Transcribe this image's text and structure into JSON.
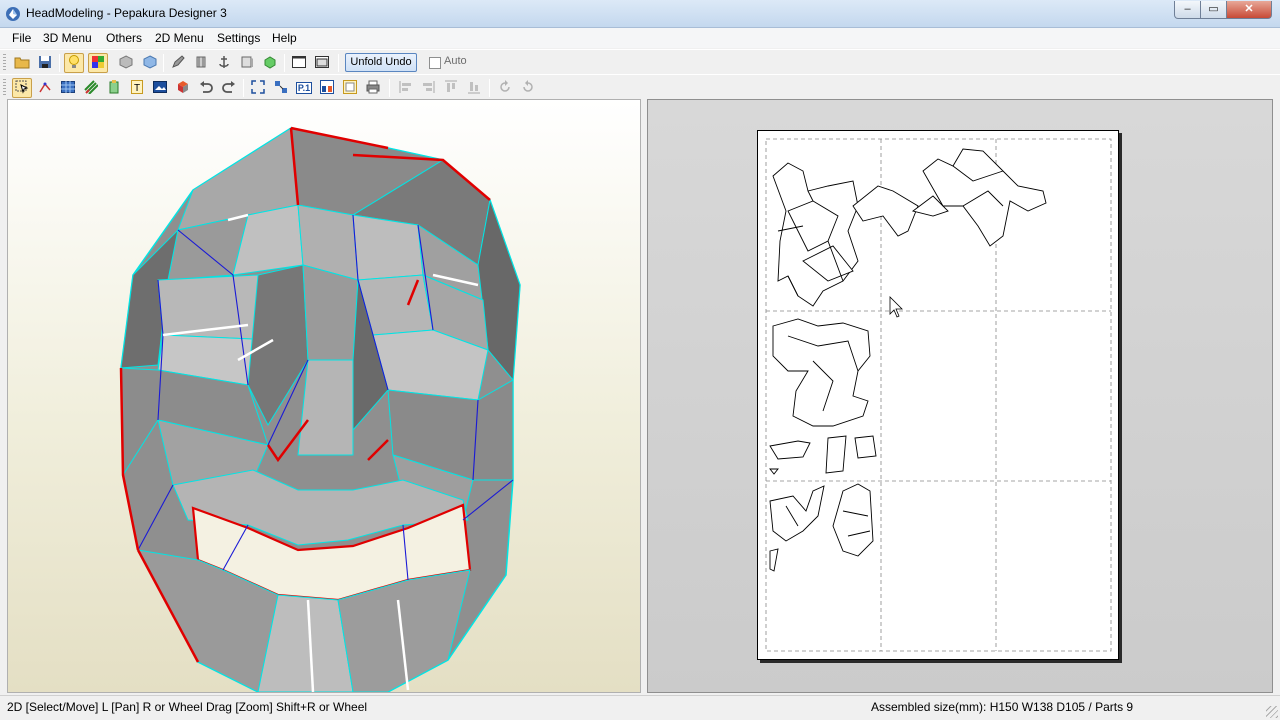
{
  "window": {
    "title": "HeadModeling - Pepakura Designer 3",
    "controls": {
      "minimize": "–",
      "maximize": "▭",
      "close": "✕"
    }
  },
  "menu": [
    "File",
    "3D Menu",
    "Others",
    "2D Menu",
    "Settings",
    "Help"
  ],
  "toolbar": {
    "unfold_undo_label": "Unfold Undo",
    "auto_label": "Auto",
    "auto_checked": false
  },
  "toolbar2": {
    "page_number_label": "P.1"
  },
  "status": {
    "left": "2D [Select/Move] L [Pan] R or Wheel Drag [Zoom] Shift+R or Wheel",
    "right": "Assembled size(mm): H150 W138 D105 / Parts 9"
  },
  "colors": {
    "face_light": "#b3b3b3",
    "face_dark": "#6e6e6e",
    "mountain_fold": "#00e5e5",
    "valley_fold": "#1a1ad6",
    "cut_edge": "#e00000",
    "toggle_active": "#fce8a8"
  },
  "icons": {
    "toolbar1": [
      "open-icon",
      "save-icon",
      "light-icon",
      "texture-icon",
      "cube-icon",
      "cube-textured-icon",
      "edit-icon",
      "flap-icon",
      "anchor-icon",
      "section-icon",
      "part-icon",
      "view-single-icon",
      "view-split-icon"
    ],
    "toolbar2": [
      "select-icon",
      "connect-icon",
      "grid-icon",
      "stripes-icon",
      "flap-edit-icon",
      "text-icon",
      "image-icon",
      "unfold-icon",
      "undo-icon",
      "redo-icon",
      "fit-icon",
      "arrange-icon",
      "page-icon",
      "layout-icon",
      "print-preview-icon",
      "print-icon",
      "align-left-icon",
      "align-right-icon",
      "align-top-icon",
      "align-bottom-icon",
      "rotate-left-icon",
      "rotate-right-icon"
    ]
  }
}
